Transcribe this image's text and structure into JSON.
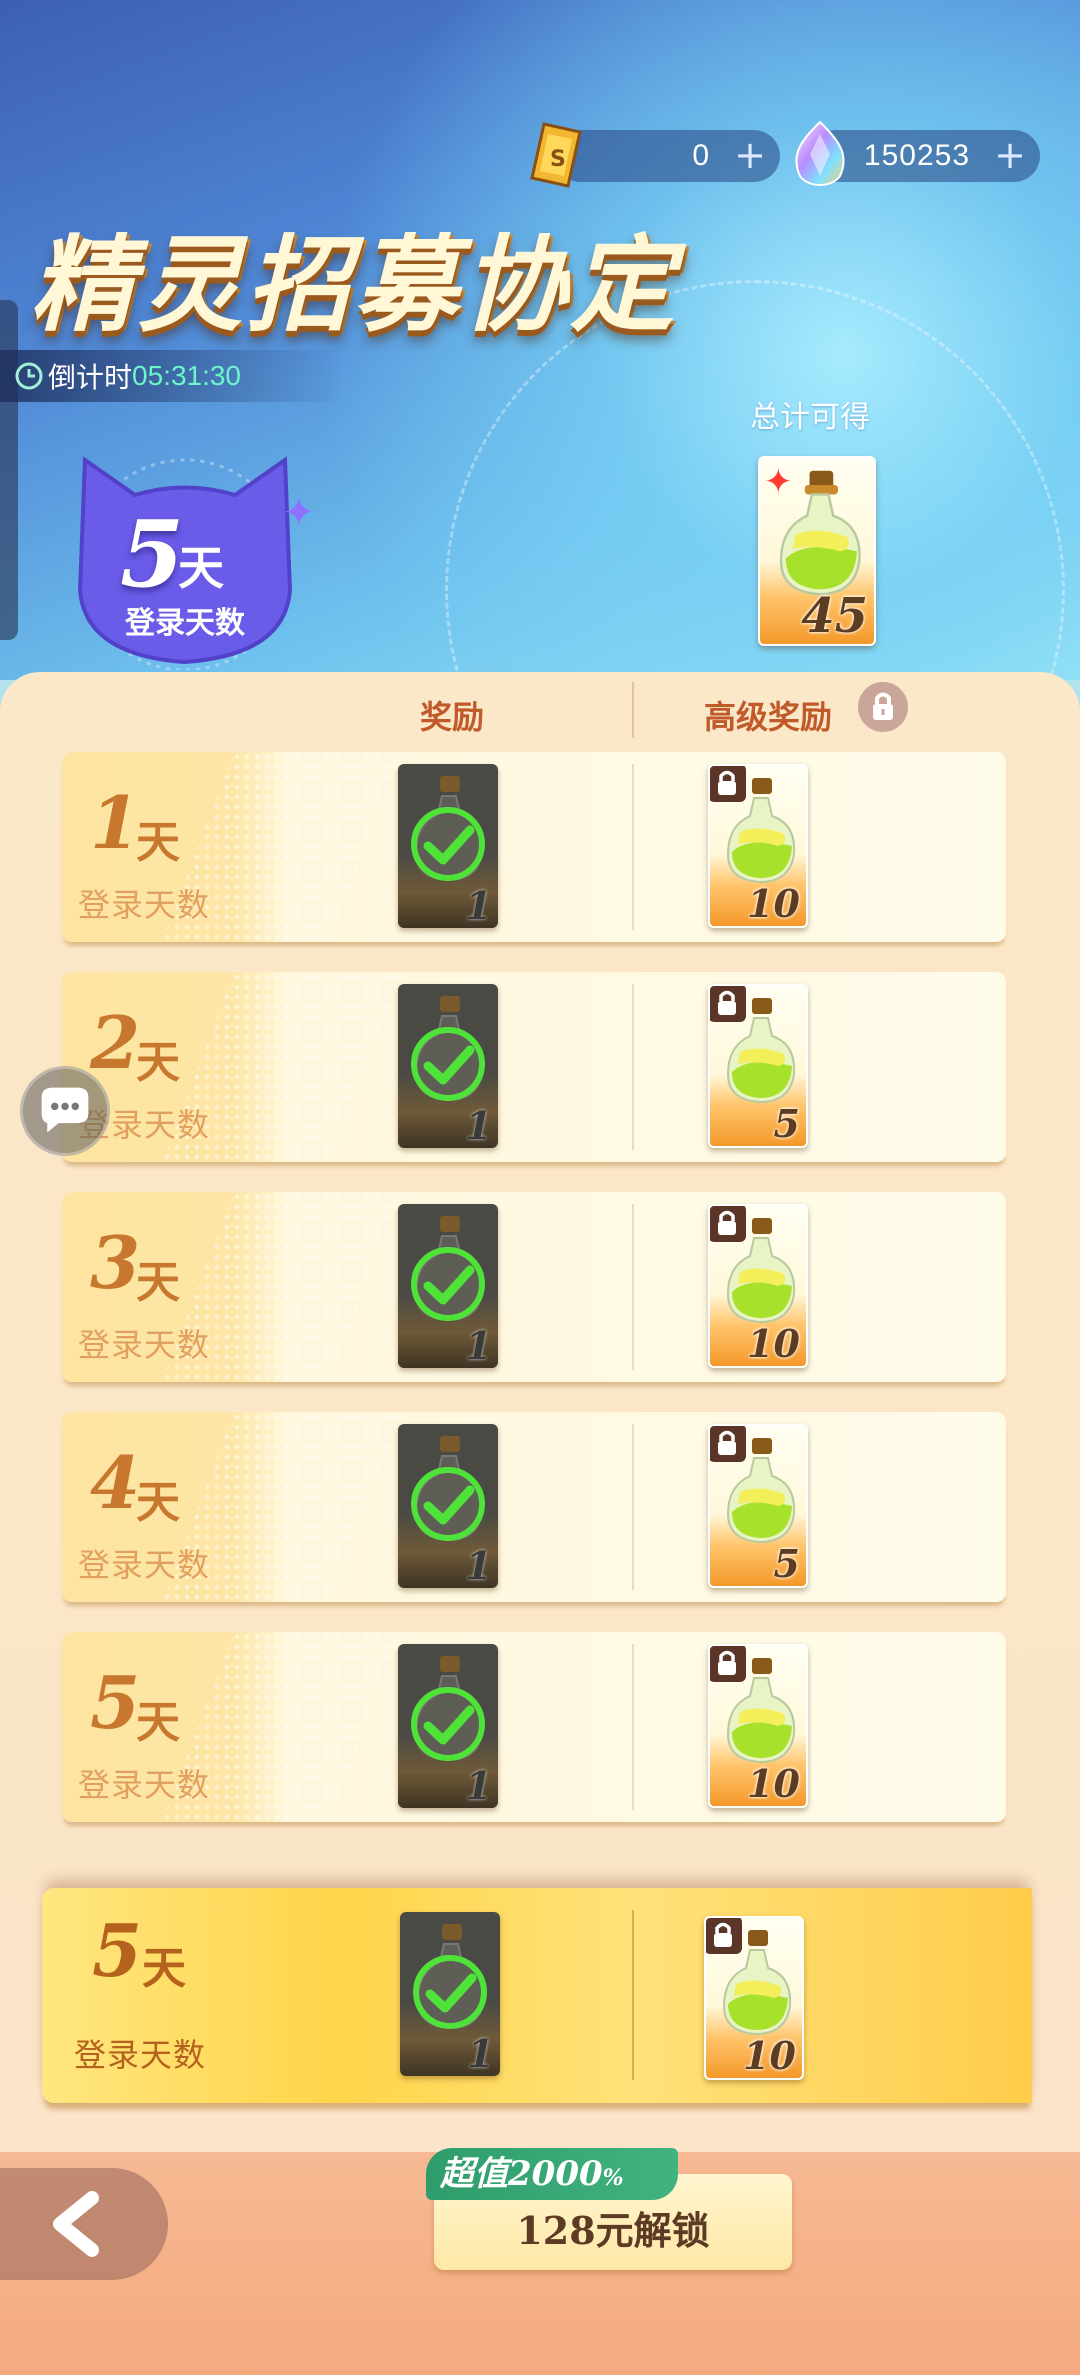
{
  "currency": {
    "tickets": "0",
    "gems": "150253",
    "add_label": "+"
  },
  "title": "精灵招募协定",
  "countdown": {
    "label": "倒计时",
    "time": "05:31:30"
  },
  "badge": {
    "days": "5",
    "unit": "天",
    "label": "登录天数"
  },
  "total": {
    "label": "总计可得",
    "quantity": "45"
  },
  "columns": {
    "reward": "奖励",
    "premium": "高级奖励"
  },
  "rows": [
    {
      "day": "1",
      "unit": "天",
      "label": "登录天数",
      "reward_qty": "1",
      "premium_qty": "10"
    },
    {
      "day": "2",
      "unit": "天",
      "label": "登录天数",
      "reward_qty": "1",
      "premium_qty": "5"
    },
    {
      "day": "3",
      "unit": "天",
      "label": "登录天数",
      "reward_qty": "1",
      "premium_qty": "10"
    },
    {
      "day": "4",
      "unit": "天",
      "label": "登录天数",
      "reward_qty": "1",
      "premium_qty": "5"
    },
    {
      "day": "5",
      "unit": "天",
      "label": "登录天数",
      "reward_qty": "1",
      "premium_qty": "10"
    }
  ],
  "final_row": {
    "day": "5",
    "unit": "天",
    "label": "登录天数",
    "reward_qty": "1",
    "premium_qty": "10"
  },
  "promo": {
    "label": "超值2000",
    "suffix": "%"
  },
  "unlock": {
    "label": "128元解锁"
  }
}
